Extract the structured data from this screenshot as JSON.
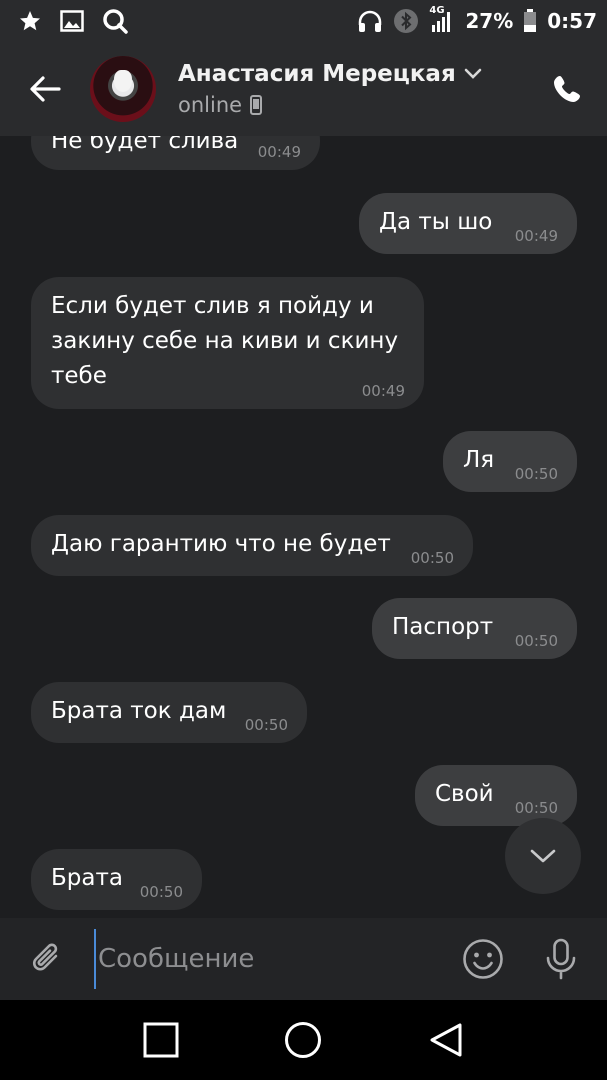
{
  "status_bar": {
    "network": "4G",
    "battery": "27%",
    "time": "0:57"
  },
  "header": {
    "contact_name": "Анастасия Мерецкая",
    "contact_status": "online"
  },
  "messages": [
    {
      "direction": "in",
      "text": "Не будет слива",
      "time": "00:49"
    },
    {
      "direction": "out",
      "text": "Да ты шо",
      "time": "00:49"
    },
    {
      "direction": "in",
      "text": "Если будет слив я пойду и\nзакину себе на киви и скину\nтебе",
      "time": "00:49"
    },
    {
      "direction": "out",
      "text": "Ля",
      "time": "00:50"
    },
    {
      "direction": "in",
      "text": "Даю гарантию что не будет",
      "time": "00:50"
    },
    {
      "direction": "out",
      "text": "Паспорт",
      "time": "00:50"
    },
    {
      "direction": "in",
      "text": "Брата ток дам",
      "time": "00:50"
    },
    {
      "direction": "out",
      "text": "Свой",
      "time": "00:50"
    },
    {
      "direction": "in",
      "text": "Брата",
      "time": "00:50"
    }
  ],
  "composer": {
    "placeholder": "Сообщение",
    "value": ""
  },
  "icons": {
    "status_left": [
      "star-icon",
      "image-icon",
      "search-app-icon"
    ],
    "status_right": [
      "headphones-icon",
      "bluetooth-icon",
      "signal-icon",
      "battery-icon"
    ],
    "header": [
      "back-arrow-icon",
      "chevron-down-icon",
      "phone-device-icon",
      "phone-call-icon"
    ],
    "composer": [
      "paperclip-icon",
      "emoji-icon",
      "microphone-icon"
    ],
    "navbar": [
      "recents-square-icon",
      "home-circle-icon",
      "back-triangle-icon"
    ]
  },
  "colors": {
    "background": "#1d1e20",
    "bar": "#2a2b2d",
    "incoming_bubble": "#2f3032",
    "outgoing_bubble": "#3d3e40",
    "caret": "#4a8bd8"
  }
}
